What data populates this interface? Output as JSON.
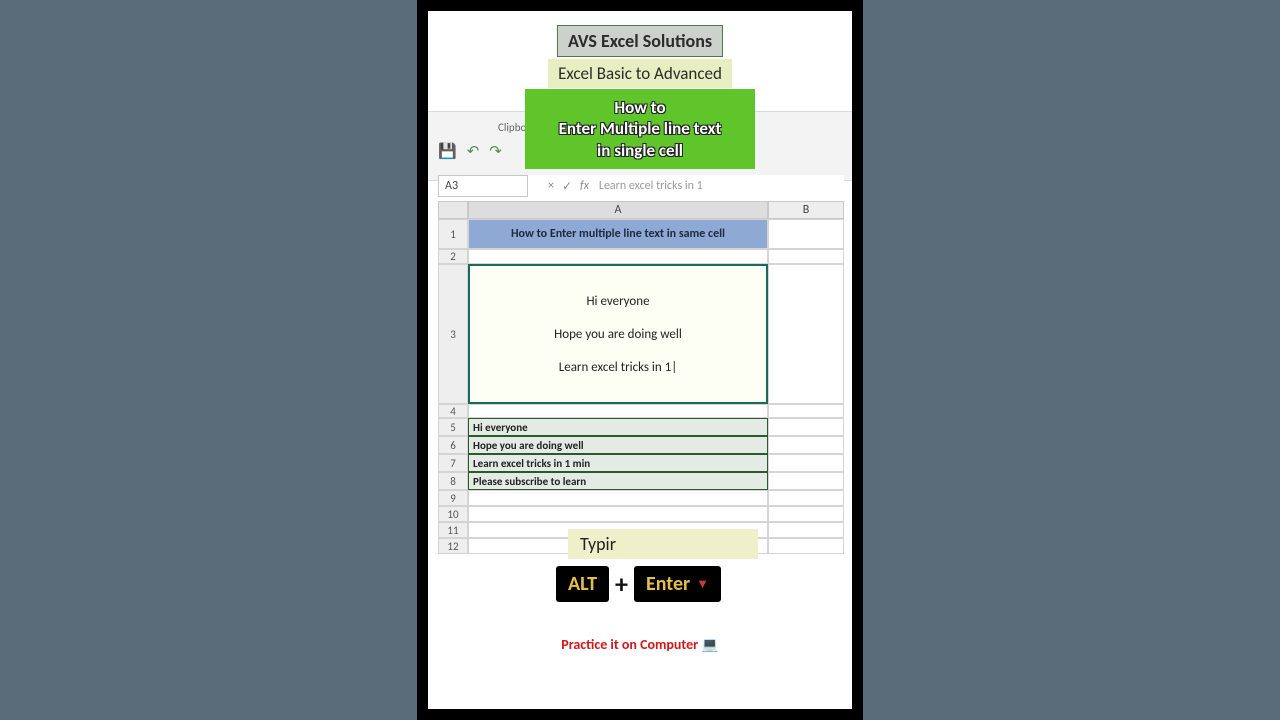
{
  "badges": {
    "title": "AVS Excel Solutions",
    "subtitle": "Excel Basic to Advanced"
  },
  "green_banner": {
    "line1": "How to",
    "line2": "Enter Multiple line text",
    "line3": "in single cell"
  },
  "ribbon": {
    "clipboard_label": "Clipboar"
  },
  "formula_bar": {
    "namebox": "A3",
    "fx_label": "fx",
    "formula_text": "Learn excel tricks in 1"
  },
  "columns": {
    "A": "A",
    "B": "B"
  },
  "rows": {
    "r1": {
      "num": "1",
      "text": "How to Enter multiple line text in same cell"
    },
    "r2": {
      "num": "2"
    },
    "r3": {
      "num": "3",
      "line1": "Hi everyone",
      "line2": "Hope you are doing well",
      "line3": "Learn excel tricks in 1|"
    },
    "r4": {
      "num": "4"
    },
    "r5": {
      "num": "5",
      "text": "Hi everyone"
    },
    "r6": {
      "num": "6",
      "text": "Hope you are doing well"
    },
    "r7": {
      "num": "7",
      "text": "Learn excel tricks in 1 min"
    },
    "r8": {
      "num": "8",
      "text": "Please subscribe to learn"
    },
    "r9": {
      "num": "9"
    },
    "r10": {
      "num": "10"
    },
    "r11": {
      "num": "11"
    },
    "r12": {
      "num": "12"
    }
  },
  "overlays": {
    "typir": "Typir",
    "key_alt": "ALT",
    "key_enter": "Enter",
    "plus": "+",
    "practice": "Practice it on Computer 💻"
  }
}
